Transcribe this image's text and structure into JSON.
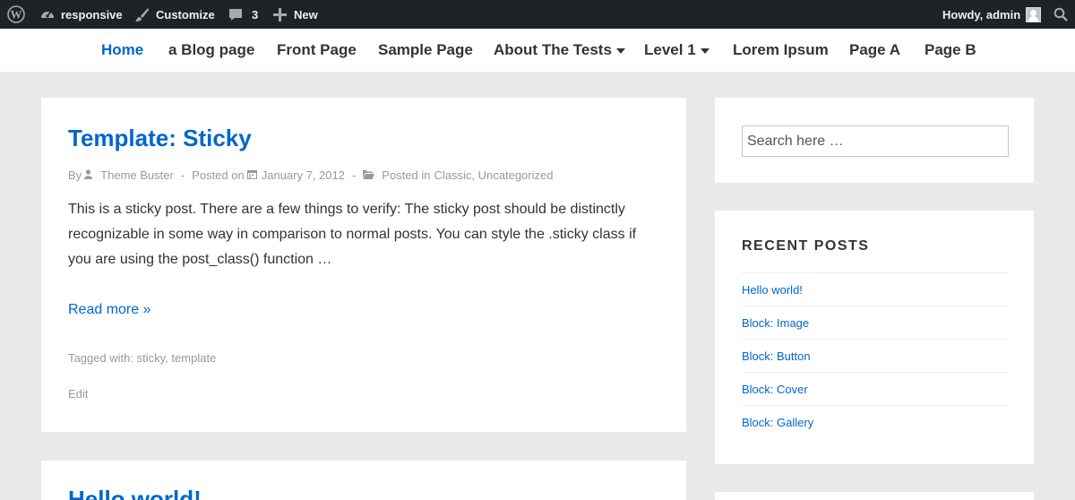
{
  "adminbar": {
    "site_name": "responsive",
    "customize": "Customize",
    "comments_count": "3",
    "new_label": "New",
    "howdy": "Howdy, admin"
  },
  "nav": {
    "items": [
      {
        "label": "Home",
        "active": true
      },
      {
        "label": "a Blog page"
      },
      {
        "label": "Front Page"
      },
      {
        "label": "Sample Page"
      },
      {
        "label": "About The Tests",
        "has_dropdown": true
      },
      {
        "label": "Level 1",
        "has_dropdown": true
      },
      {
        "label": "Lorem Ipsum"
      },
      {
        "label": "Page A"
      },
      {
        "label": "Page B"
      }
    ]
  },
  "posts": [
    {
      "title": "Template: Sticky",
      "by_label": "By",
      "author": "Theme Buster",
      "posted_on_label": "Posted on",
      "date": "January 7, 2012",
      "posted_in_label": "Posted in",
      "categories": [
        "Classic",
        "Uncategorized"
      ],
      "excerpt": "This is a sticky post. There are a few things to verify: The sticky post should be distinctly recognizable in some way in comparison to normal posts. You can style the .sticky class if you are using the post_class() function …",
      "read_more": "Read more »",
      "tagged_label": "Tagged with:",
      "tags": [
        "sticky",
        "template"
      ],
      "edit": "Edit"
    },
    {
      "title": "Hello world!"
    }
  ],
  "sidebar": {
    "search_placeholder": "Search here …",
    "recent_title": "RECENT POSTS",
    "recent_posts": [
      "Hello world!",
      "Block: Image",
      "Block: Button",
      "Block: Cover",
      "Block: Gallery"
    ]
  },
  "colors": {
    "accent": "#0066cc",
    "adminbar_bg": "#1d2327",
    "page_bg": "#e9e9e9"
  }
}
